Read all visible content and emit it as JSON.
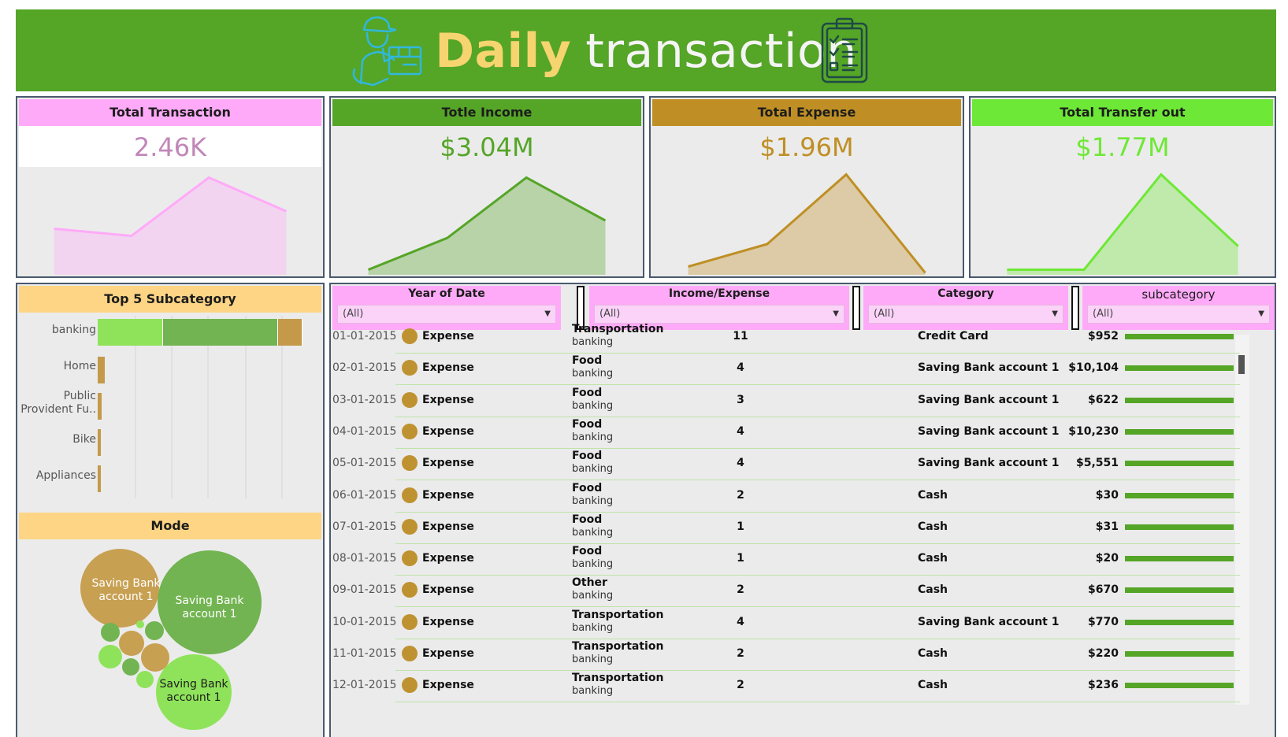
{
  "banner": {
    "title_bold": "Daily",
    "title_rest": "transaction",
    "left_icon": "delivery-man-icon",
    "right_icon": "checklist-clipboard-icon",
    "background": "#55a527"
  },
  "kpis": [
    {
      "label": "Total Transaction",
      "value": "2.46K",
      "header_color": "#ffaaf8",
      "value_color": "#c187b8",
      "spark": [
        0.45,
        0.38,
        0.95,
        0.62
      ]
    },
    {
      "label": "Totle Income",
      "value": "$3.04M",
      "header_color": "#55a527",
      "value_color": "#55a527",
      "spark": [
        0.05,
        0.36,
        0.95,
        0.53
      ]
    },
    {
      "label": "Total Expense",
      "value": "$1.96M",
      "header_color": "#bf8f25",
      "value_color": "#bf8f25",
      "spark": [
        0.08,
        0.3,
        0.98,
        0.02
      ]
    },
    {
      "label": "Total Transfer out",
      "value": "$1.77M",
      "header_color": "#6ee836",
      "value_color": "#6ee836",
      "spark": [
        0.05,
        0.05,
        0.98,
        0.28
      ]
    }
  ],
  "top5": {
    "title": "Top 5 Subcategory",
    "labels": [
      "banking",
      "Home",
      "Public Provident Fu..",
      "Bike",
      "Appliances"
    ],
    "banking_segments": [
      {
        "share": 0.32,
        "color": "#8fe35a"
      },
      {
        "share": 0.56,
        "color": "#72b451"
      },
      {
        "share": 0.12,
        "color": "#c49a4a"
      }
    ],
    "bar_color": "#c49a4a",
    "relative_sizes": [
      1.0,
      0.036,
      0.02,
      0.016,
      0.012
    ]
  },
  "mode": {
    "title": "Mode",
    "bubble_label": "Saving Bank account 1",
    "colors": {
      "tan": "#c8a052",
      "green": "#72b451",
      "light": "#8fe35a"
    }
  },
  "filters": [
    {
      "label": "Year of Date",
      "value": "(All)"
    },
    {
      "label": "Income/Expense",
      "value": "(All)"
    },
    {
      "label": "Category",
      "value": "(All)"
    },
    {
      "label": "subcategory",
      "value": "(All)"
    }
  ],
  "table": {
    "dot_color": "#bf9231",
    "bar_color": "#55a527",
    "rows": [
      {
        "date": "01-01-2015",
        "type": "Expense",
        "category": "Transportation",
        "subcategory": "banking",
        "count": "11",
        "mode": "Credit Card",
        "amount": "$952"
      },
      {
        "date": "02-01-2015",
        "type": "Expense",
        "category": "Food",
        "subcategory": "banking",
        "count": "4",
        "mode": "Saving Bank account 1",
        "amount": "$10,104"
      },
      {
        "date": "03-01-2015",
        "type": "Expense",
        "category": "Food",
        "subcategory": "banking",
        "count": "3",
        "mode": "Saving Bank account 1",
        "amount": "$622"
      },
      {
        "date": "04-01-2015",
        "type": "Expense",
        "category": "Food",
        "subcategory": "banking",
        "count": "4",
        "mode": "Saving Bank account 1",
        "amount": "$10,230"
      },
      {
        "date": "05-01-2015",
        "type": "Expense",
        "category": "Food",
        "subcategory": "banking",
        "count": "4",
        "mode": "Saving Bank account 1",
        "amount": "$5,551"
      },
      {
        "date": "06-01-2015",
        "type": "Expense",
        "category": "Food",
        "subcategory": "banking",
        "count": "2",
        "mode": "Cash",
        "amount": "$30"
      },
      {
        "date": "07-01-2015",
        "type": "Expense",
        "category": "Food",
        "subcategory": "banking",
        "count": "1",
        "mode": "Cash",
        "amount": "$31"
      },
      {
        "date": "08-01-2015",
        "type": "Expense",
        "category": "Food",
        "subcategory": "banking",
        "count": "1",
        "mode": "Cash",
        "amount": "$20"
      },
      {
        "date": "09-01-2015",
        "type": "Expense",
        "category": "Other",
        "subcategory": "banking",
        "count": "2",
        "mode": "Cash",
        "amount": "$670"
      },
      {
        "date": "10-01-2015",
        "type": "Expense",
        "category": "Transportation",
        "subcategory": "banking",
        "count": "4",
        "mode": "Saving Bank account 1",
        "amount": "$770"
      },
      {
        "date": "11-01-2015",
        "type": "Expense",
        "category": "Transportation",
        "subcategory": "banking",
        "count": "2",
        "mode": "Cash",
        "amount": "$220"
      },
      {
        "date": "12-01-2015",
        "type": "Expense",
        "category": "Transportation",
        "subcategory": "banking",
        "count": "2",
        "mode": "Cash",
        "amount": "$236"
      }
    ]
  }
}
